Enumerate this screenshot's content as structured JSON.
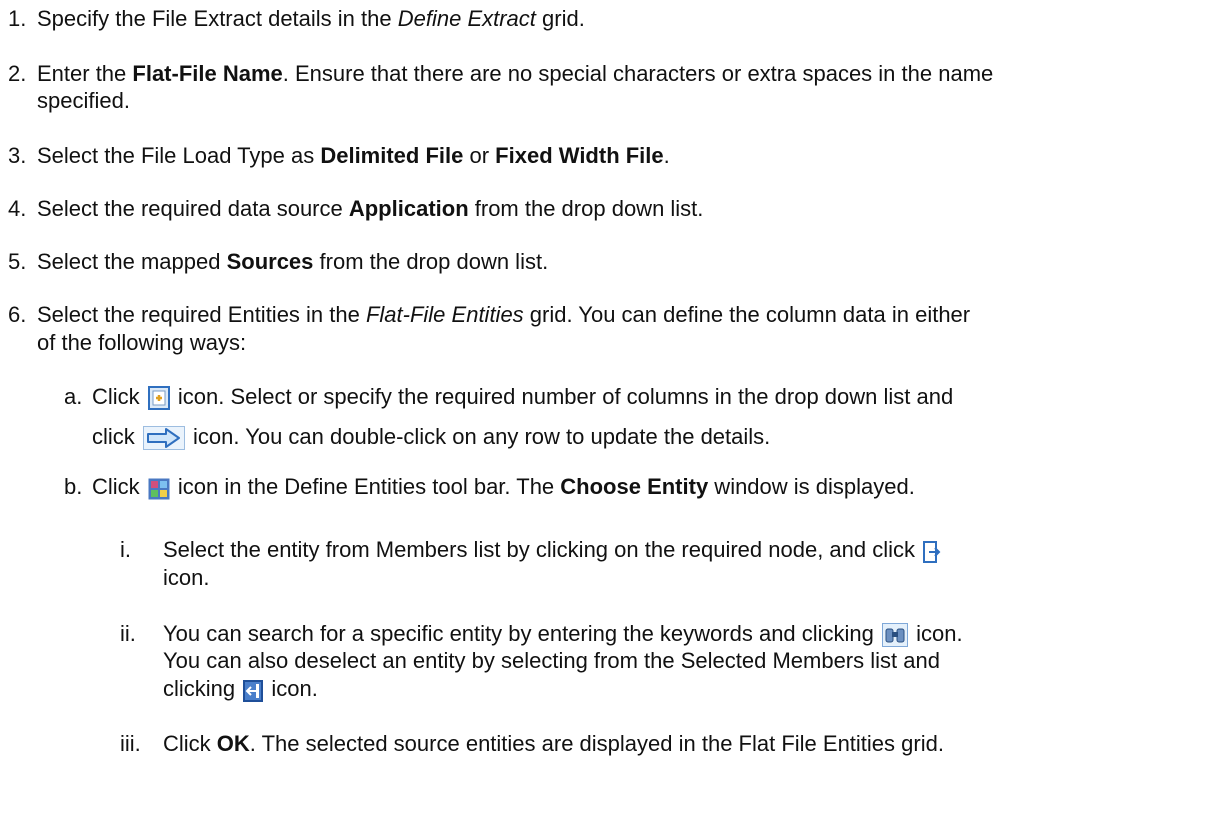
{
  "steps": [
    {
      "num": "1.",
      "t1": "Specify the File Extract details in the ",
      "em": "Define Extract",
      "t2": " grid."
    },
    {
      "num": "2.",
      "t1": "Enter the ",
      "b": "Flat-File Name",
      "t2": ". Ensure that there are no special characters or extra spaces in the name",
      "t3": "specified."
    },
    {
      "num": "3.",
      "t1": "Select the File Load Type as ",
      "b1": "Delimited File",
      "t2": " or ",
      "b2": "Fixed Width File",
      "t3": "."
    },
    {
      "num": "4.",
      "t1": "Select the required data source ",
      "b": "Application",
      "t2": " from the drop down list."
    },
    {
      "num": "5.",
      "t1": "Select the mapped ",
      "b": "Sources",
      "t2": " from the drop down list."
    },
    {
      "num": "6.",
      "t1": "Select the required Entities in the ",
      "em": "Flat-File Entities",
      "t2": " grid. You can define the column data in either",
      "t3": "of the following ways:"
    }
  ],
  "sub_a": {
    "num": "a.",
    "t1": "Click ",
    "t2": " icon. Select or specify the required number of columns in the drop down list and",
    "t3": "click ",
    "t4": " icon. You can double-click on any row to update the details."
  },
  "sub_b": {
    "num": "b.",
    "t1": "Click ",
    "t2": " icon in the Define Entities tool bar. The ",
    "b": "Choose Entity",
    "t3": " window is displayed."
  },
  "sub_i": {
    "num": "i.",
    "t1": "Select the entity from Members list by clicking on the required node, and click ",
    "t2": "icon."
  },
  "sub_ii": {
    "num": "ii.",
    "t1": "You can search for a specific entity by entering the keywords and clicking ",
    "t2": " icon.",
    "t3": "You can also deselect an entity by selecting from the Selected Members list and",
    "t4": "clicking ",
    "t5": " icon."
  },
  "sub_iii": {
    "num": "iii.",
    "t1": "Click ",
    "b": "OK",
    "t2": ". The selected source entities are displayed in the Flat File Entities grid."
  },
  "icons": {
    "add_columns": "add-columns-icon",
    "go_arrow": "right-arrow-icon",
    "choose_entity": "choose-entity-icon",
    "move_right": "move-right-icon",
    "search": "binoculars-search-icon",
    "move_left": "move-left-icon"
  },
  "colors": {
    "text": "#111111",
    "icon_blue": "#2f6fbf",
    "icon_light": "#dbe9f7"
  }
}
